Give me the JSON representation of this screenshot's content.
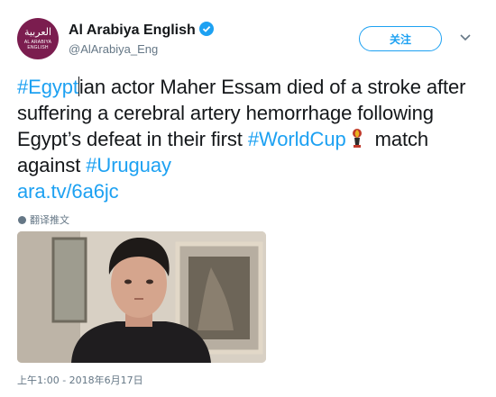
{
  "account": {
    "name": "Al Arabiya English",
    "handle": "@AlArabiya_Eng",
    "avatar_text_ar": "العربية",
    "avatar_text_en": "AL ARABIYA ENGLISH"
  },
  "follow_label": "关注",
  "tweet": {
    "hashtag1": "#Egypt",
    "text1": "ian actor Maher Essam died of a stroke after suffering a cerebral artery hemorrhage following Egypt’s defeat in their first ",
    "hashtag2": "#WorldCup",
    "text2": " match against ",
    "hashtag3": "#Uruguay",
    "link": "ara.tv/6a6jc"
  },
  "translate_label": "翻译推文",
  "timestamp": "上午1:00 - 2018年6月17日",
  "icons": {
    "verified": "verified-badge-icon",
    "more": "chevron-down-icon",
    "worldcup": "world-cup-trophy-icon",
    "translate": "globe-icon"
  },
  "colors": {
    "link": "#1da1f2",
    "text": "#14171a",
    "muted": "#657786",
    "avatar_bg": "#7b1d4f"
  }
}
